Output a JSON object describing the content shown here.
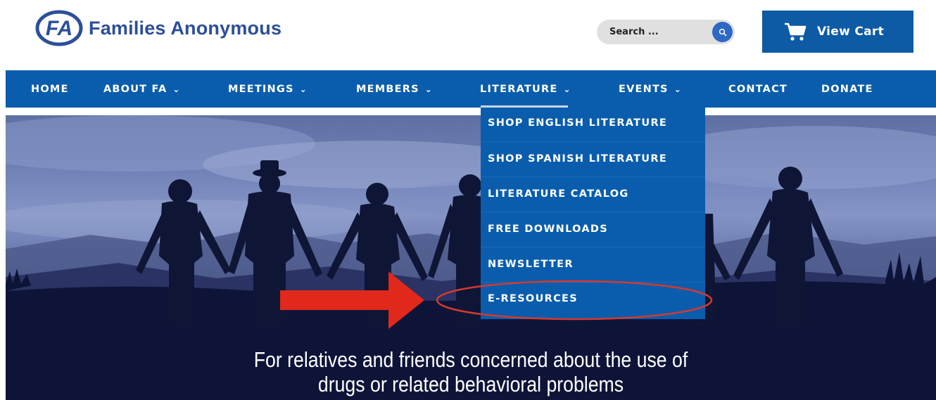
{
  "header": {
    "logo_mark": "FA",
    "logo_text": "Families Anonymous",
    "search_placeholder": "Search ...",
    "cart_label": "View Cart"
  },
  "nav": {
    "items": [
      {
        "label": "HOME",
        "has_dropdown": false
      },
      {
        "label": "ABOUT FA",
        "has_dropdown": true
      },
      {
        "label": "MEETINGS",
        "has_dropdown": true
      },
      {
        "label": "MEMBERS",
        "has_dropdown": true
      },
      {
        "label": "LITERATURE",
        "has_dropdown": true,
        "active": true
      },
      {
        "label": "EVENTS",
        "has_dropdown": true
      },
      {
        "label": "CONTACT",
        "has_dropdown": false
      },
      {
        "label": "DONATE",
        "has_dropdown": false
      }
    ],
    "caret": "⌄"
  },
  "literature_menu": {
    "items": [
      "SHOP ENGLISH LITERATURE",
      "SHOP SPANISH LITERATURE",
      "LITERATURE CATALOG",
      "FREE DOWNLOADS",
      "NEWSLETTER",
      "E-RESOURCES"
    ],
    "highlighted": "E-RESOURCES"
  },
  "hero": {
    "tagline_line1": "For relatives and friends concerned about the use of",
    "tagline_line2": "drugs or related behavioral problems"
  },
  "colors": {
    "brand_blue": "#0a5dad",
    "logo_blue": "#2c4f99",
    "search_button": "#2f67c4",
    "arrow_red": "#e0281b",
    "ellipse_red": "#d43a2f"
  },
  "icons": {
    "search": "search-icon",
    "cart": "cart-icon",
    "arrow": "red-arrow-annotation",
    "ellipse": "red-ellipse-annotation"
  }
}
